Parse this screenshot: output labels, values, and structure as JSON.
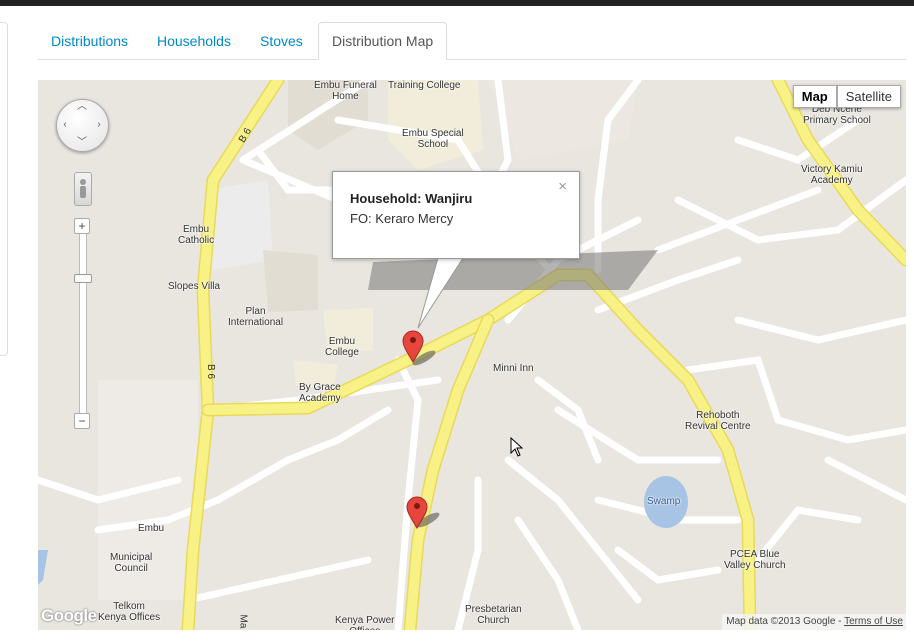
{
  "tabs": [
    {
      "label": "Distributions"
    },
    {
      "label": "Households"
    },
    {
      "label": "Stoves"
    },
    {
      "label": "Distribution Map",
      "active": true
    }
  ],
  "map": {
    "type_controls": {
      "map": "Map",
      "satellite": "Satellite",
      "selected": "Map"
    },
    "zoom_in": "+",
    "zoom_out": "−",
    "info_window": {
      "title": "Household: Wanjiru",
      "subtitle": "FO: Keraro Mercy",
      "close": "×"
    },
    "attribution": {
      "text": "Map data ©2013 Google - ",
      "terms": "Terms of Use"
    },
    "logo": "Google",
    "labels": {
      "embu_funeral_home": "Embu Funeral\nHome",
      "training_college": "Training College",
      "embu_special_school": "Embu Special\nSchool",
      "deb_primary": "Deb Ncene\nPrimary School",
      "victory_kamiu": "Victory Kamiu\nAcademy",
      "embu_catholic": "Embu\nCatholic",
      "slopes_villa": "Slopes Villa",
      "plan_international": "Plan\nInternational",
      "embu_college": "Embu\nCollege",
      "by_grace": "By Grace\nAcademy",
      "minni_inn": "Minni Inn",
      "rehoboth": "Rehoboth\nRevival Centre",
      "swamp": "Swamp",
      "pcea": "PCEA Blue\nValley Church",
      "embu": "Embu",
      "municipal_council": "Municipal\nCouncil",
      "telkom": "Telkom\nKenya Offices",
      "kenya_power": "Kenya Power\nOffices",
      "presbyterian": "Presbetarian\nChurch",
      "b6_top": "B 6",
      "b6_mid": "B 6",
      "ma": "Ma"
    }
  },
  "colors": {
    "accent": "#0088cc",
    "major_road": "#f8f286",
    "road_edge": "#e9d95a",
    "water": "#a7c4e4",
    "marker": "#e8453c"
  }
}
